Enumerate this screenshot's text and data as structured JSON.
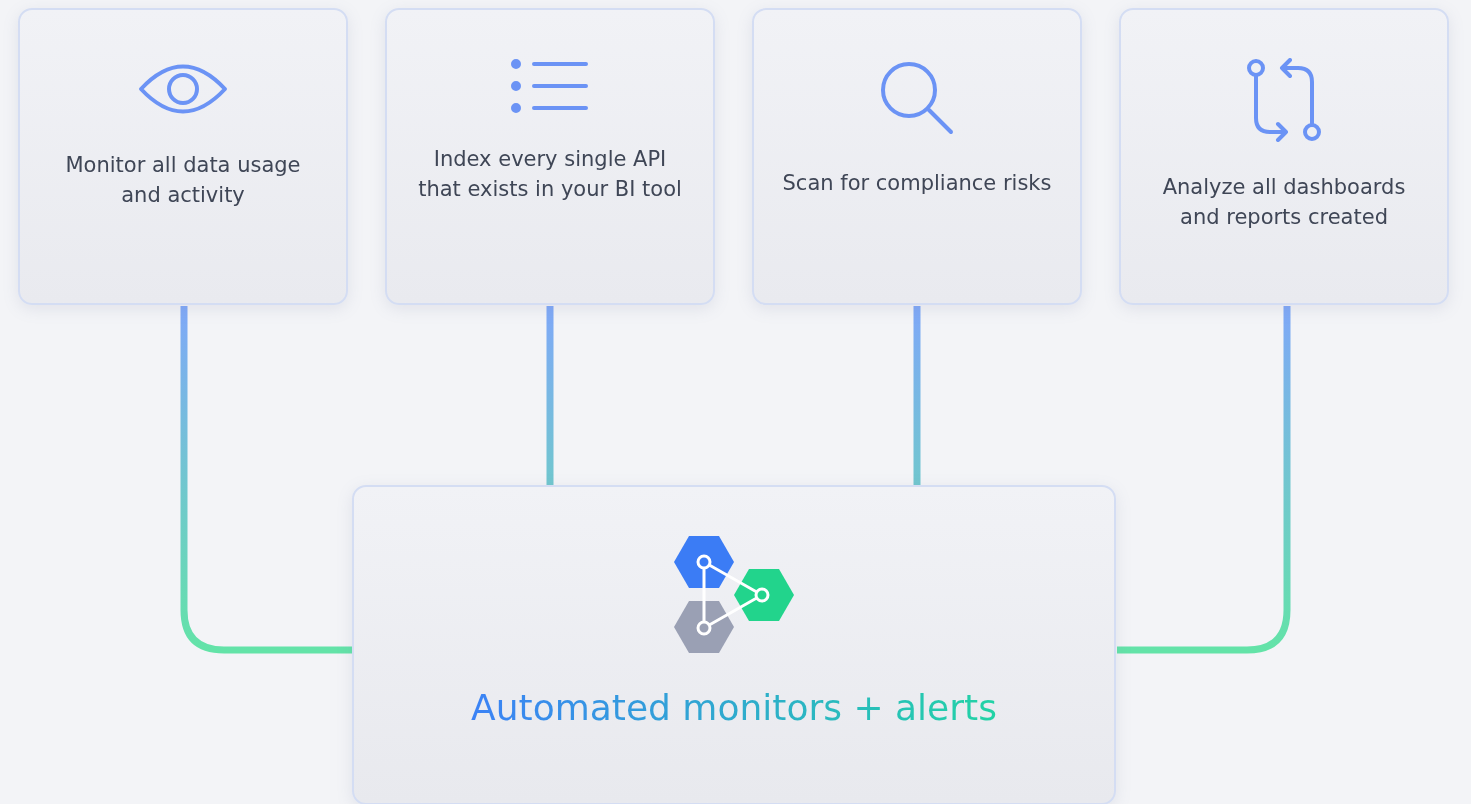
{
  "sources": [
    {
      "kind": "eye",
      "text": "Monitor all data usage and activity"
    },
    {
      "kind": "list",
      "text": "Index every single API that exists in your BI tool"
    },
    {
      "kind": "search",
      "text": "Scan for compliance risks"
    },
    {
      "kind": "branch",
      "text": "Analyze all dashboards and reports created"
    }
  ],
  "hub": {
    "title": "Automated monitors + alerts"
  }
}
